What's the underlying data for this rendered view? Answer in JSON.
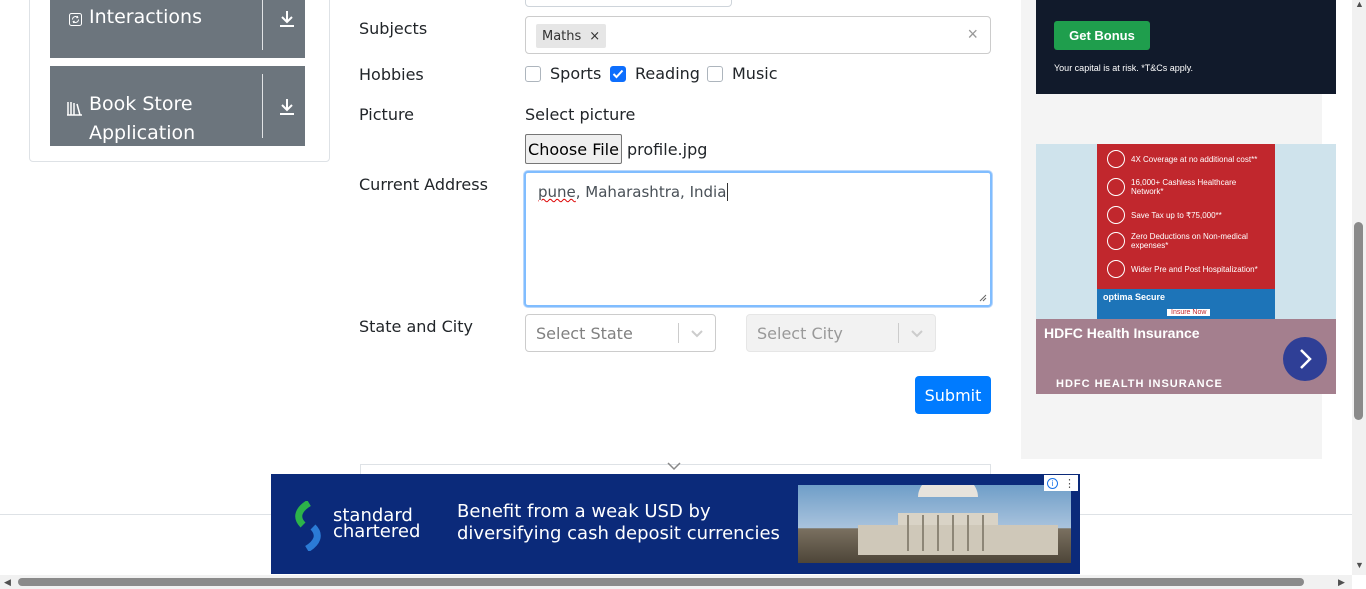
{
  "sidebar": {
    "groups": [
      {
        "label": "Interactions",
        "icon": "refresh-icon"
      },
      {
        "label": "Book Store Application",
        "icon": "books-icon"
      }
    ]
  },
  "form": {
    "subjects_label": "Subjects",
    "subjects": [
      "Maths"
    ],
    "chip_remove": "×",
    "clear_all": "×",
    "hobbies_label": "Hobbies",
    "hobbies": [
      {
        "label": "Sports",
        "checked": false
      },
      {
        "label": "Reading",
        "checked": true
      },
      {
        "label": "Music",
        "checked": false
      }
    ],
    "picture_label": "Picture",
    "select_picture": "Select picture",
    "choose_file": "Choose File",
    "file_name": "profile.jpg",
    "address_label": "Current Address",
    "address_word1": "pune",
    "address_rest": ", Maharashtra, India",
    "state_city_label": "State and City",
    "state_placeholder": "Select State",
    "city_placeholder": "Select City",
    "submit": "Submit"
  },
  "ads": {
    "top": {
      "cta": "Get Bonus",
      "note": "Your capital is at risk. *T&Cs apply."
    },
    "middle": {
      "features": [
        "4X Coverage at no additional cost**",
        "16,000+ Cashless Healthcare Network*",
        "Save Tax up to ₹75,000**",
        "Zero Deductions on Non-medical expenses*",
        "Wider Pre and Post Hospitalization*"
      ],
      "product": "optima Secure",
      "cta": "Insure Now",
      "title": "HDFC Health Insurance",
      "brand": "HDFC HEALTH INSURANCE"
    },
    "bottom": {
      "logo_line1": "standard",
      "logo_line2": "chartered",
      "headline_line1": "Benefit from a weak USD by",
      "headline_line2": "diversifying cash deposit currencies"
    }
  },
  "colors": {
    "primary": "#007bff",
    "checkbox": "#0d6efd",
    "sidebar": "#6c757d"
  }
}
